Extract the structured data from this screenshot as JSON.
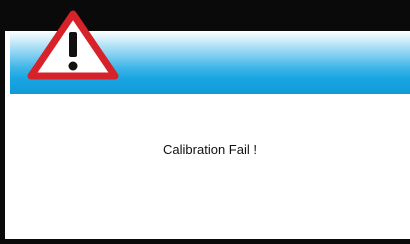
{
  "dialog": {
    "message": "Calibration Fail !",
    "icon": "warning-triangle-icon"
  },
  "colors": {
    "header_gradient_top": "#ffffff",
    "header_gradient_bottom": "#1199d8",
    "warning_red": "#d8222a",
    "frame": "#0a0a0a"
  }
}
